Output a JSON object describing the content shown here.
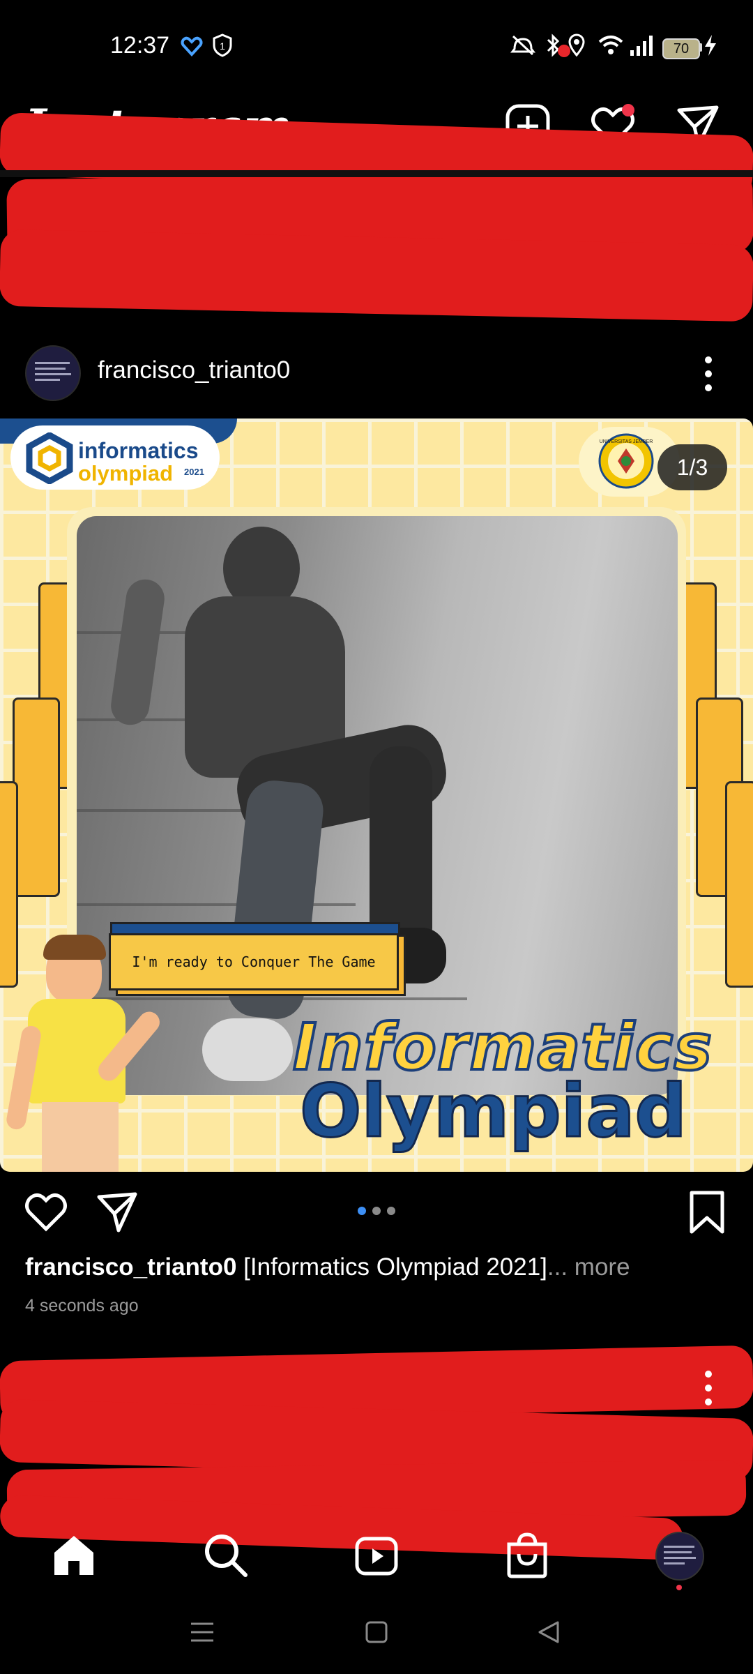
{
  "status_bar": {
    "time": "12:37",
    "battery_level": "70",
    "icons": [
      "heart-app-icon",
      "shield-icon",
      "mute-icon",
      "bluetooth-icon",
      "location-icon",
      "wifi-icon",
      "signal-icon",
      "battery-icon",
      "charging-icon"
    ]
  },
  "header": {
    "app_title": "Instagram",
    "actions": [
      "new-post-icon",
      "activity-heart-icon",
      "direct-message-icon"
    ]
  },
  "post": {
    "username": "francisco_trianto0",
    "page_indicator": "1/3",
    "image": {
      "badge_line1": "informatics",
      "badge_line2": "olympiad",
      "badge_year": "2021",
      "university_logo_text": "UNIVERSITAS JEMBER",
      "speech_text": "I'm ready to Conquer The Game",
      "title_line1": "Informatics",
      "title_line2": "Olympiad"
    },
    "carousel": {
      "count": 3,
      "active": 1
    },
    "caption_user": "francisco_trianto0",
    "caption_text": " [Informatics Olympiad 2021]",
    "caption_more": "... more",
    "timestamp": "4 seconds ago"
  },
  "bottom_nav": {
    "items": [
      "home-icon",
      "search-icon",
      "reels-icon",
      "shop-icon",
      "profile-avatar"
    ]
  },
  "colors": {
    "redaction": "#e11d1d",
    "accent_blue": "#1c4f8f",
    "accent_yellow": "#f7b836",
    "notification": "#f0344a"
  }
}
